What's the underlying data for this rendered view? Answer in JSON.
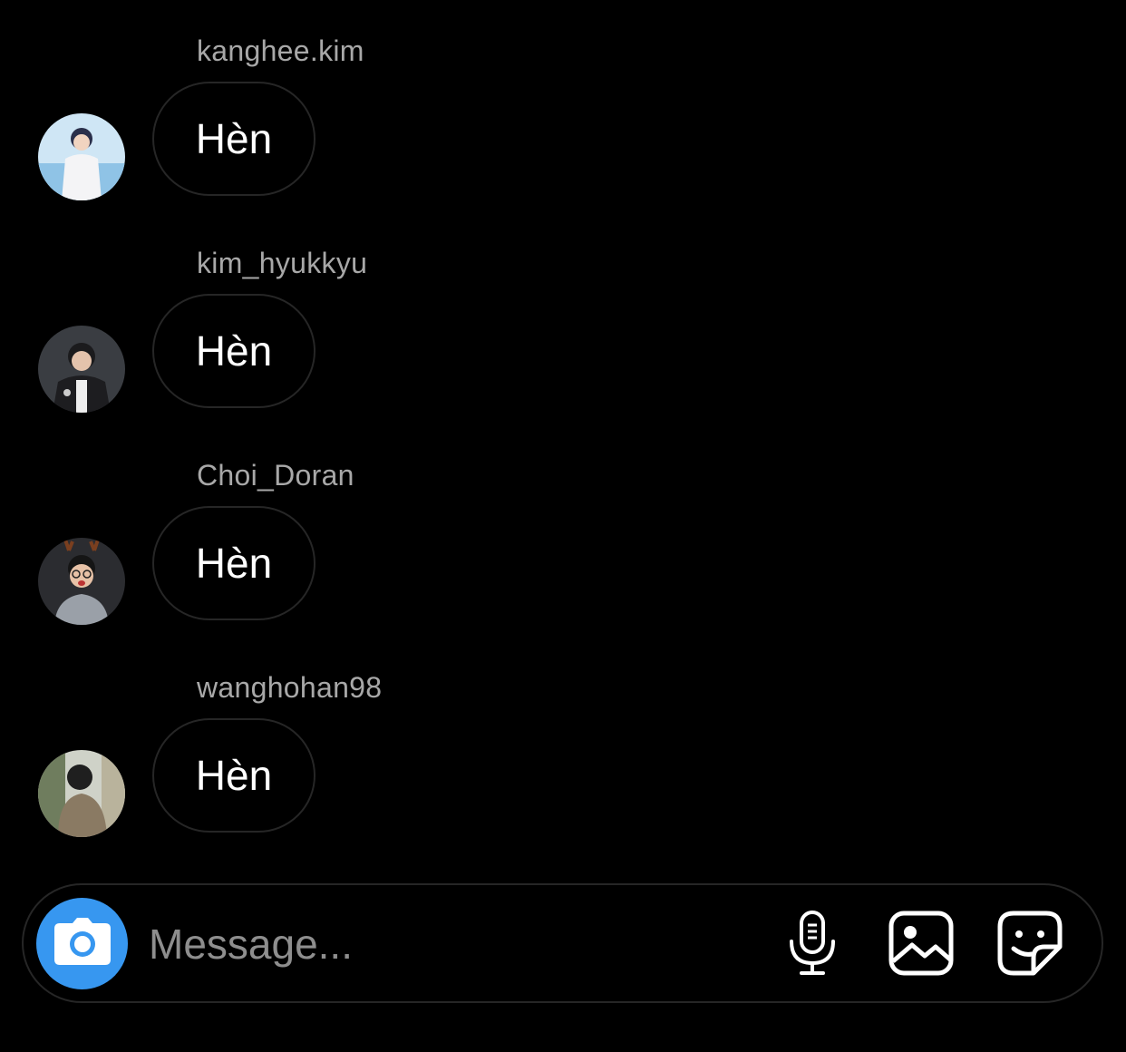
{
  "messages": [
    {
      "sender": "kanghee.kim",
      "text": "Hèn"
    },
    {
      "sender": "kim_hyukkyu",
      "text": "Hèn"
    },
    {
      "sender": "Choi_Doran",
      "text": "Hèn"
    },
    {
      "sender": "wanghohan98",
      "text": "Hèn"
    }
  ],
  "composer": {
    "placeholder": "Message...",
    "camera_icon": "camera-icon",
    "mic_icon": "microphone-icon",
    "gallery_icon": "gallery-icon",
    "sticker_icon": "sticker-icon"
  },
  "colors": {
    "background": "#000000",
    "bubble_border": "#262626",
    "accent": "#3797f0",
    "username": "#a8a8a8"
  }
}
